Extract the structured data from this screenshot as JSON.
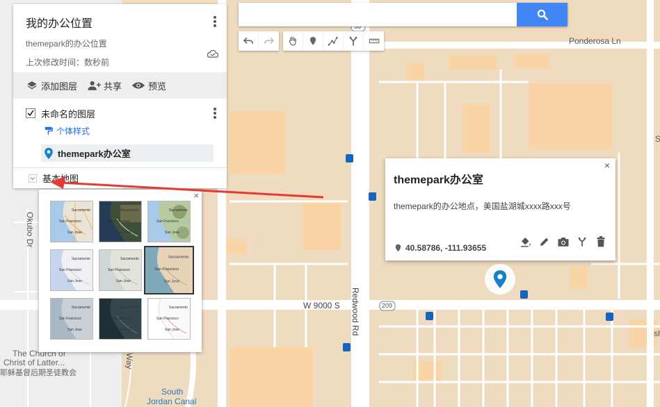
{
  "search": {
    "value": "",
    "placeholder": ""
  },
  "map_panel": {
    "title": "我的办公位置",
    "description": "themepark的办公位置",
    "last_modified": "上次修改时间：数秒前",
    "actions": {
      "add_layer": "添加图层",
      "share": "共享",
      "preview": "预览"
    },
    "layer": {
      "name": "未命名的图层",
      "style_link": "个体样式",
      "feature": "themepark办公室"
    },
    "basemap_label": "基本地图"
  },
  "basemap_picker": {
    "close": "×",
    "thumb_label_lines": [
      "Sacramento",
      "San Francisco",
      "San Jose"
    ]
  },
  "info_window": {
    "close": "×",
    "title": "themepark办公室",
    "description": "themepark的办公地点，美国盐湖城xxxx路xxx号",
    "coordinates": "40.58786, -111.93655"
  },
  "map_labels": {
    "ponderosa": "Ponderosa Ln",
    "w9000s": "W 9000 S",
    "redwood": "Redwood Rd",
    "route68": "68",
    "route209": "209",
    "okubo": "Okubo Dr",
    "way": "Way",
    "church1": "The Church of",
    "church2": "Christ of Latter...",
    "church3": "耶稣基督后期圣徒教会",
    "south1": "South",
    "south2": "Jordan Canal",
    "edge_s": "S",
    "edge_road": "sh"
  },
  "colors": {
    "map_bg": "#f2eadf",
    "urban": "#efdcc0",
    "building": "#f9d5a5",
    "road": "#ffffff",
    "accent_blue": "#4285f4",
    "pin_blue": "#1a7fc9",
    "transit": "#1565c0"
  }
}
